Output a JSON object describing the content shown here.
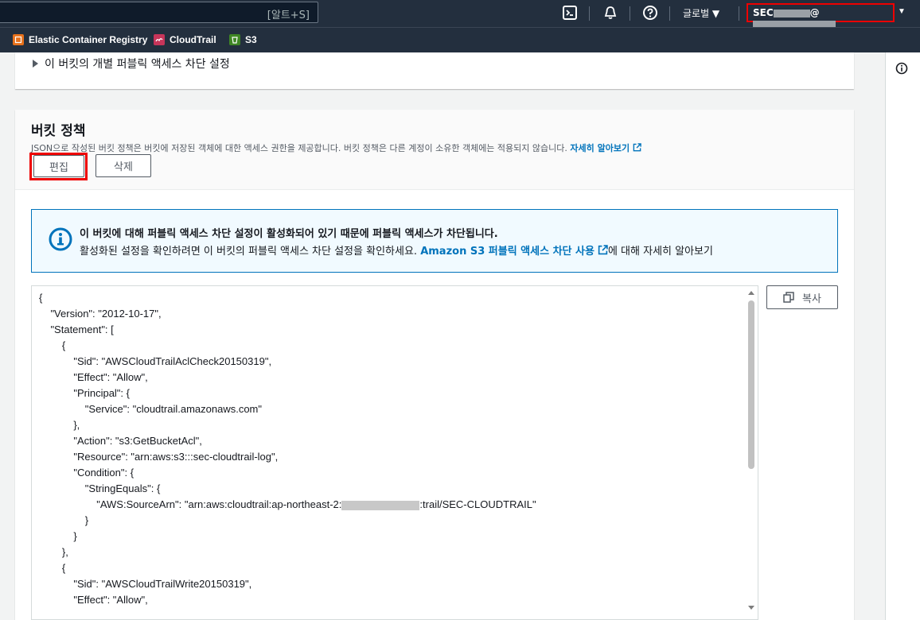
{
  "topnav": {
    "search_shortcut": "[알트+S]",
    "region": "글로벌 ▼",
    "account_prefix": "SEC",
    "account_at": "@",
    "account_caret": "▼"
  },
  "favorites": [
    {
      "label": "Elastic Container Registry",
      "icon": "ecr-icon",
      "color": "#e7711b"
    },
    {
      "label": "CloudTrail",
      "icon": "cloudtrail-icon",
      "color": "#c7355a"
    },
    {
      "label": "S3",
      "icon": "s3-icon",
      "color": "#3f8624"
    }
  ],
  "block_settings": {
    "expander_label": "이 버킷의 개별 퍼블릭 액세스 차단 설정"
  },
  "policy": {
    "title": "버킷 정책",
    "description": "JSON으로 작성된 버킷 정책은 버킷에 저장된 객체에 대한 액세스 권한을 제공합니다. 버킷 정책은 다른 계정이 소유한 객체에는 적용되지 않습니다.",
    "learn_more": "자세히 알아보기",
    "edit_label": "편집",
    "delete_label": "삭제",
    "copy_label": "복사"
  },
  "alert": {
    "title": "이 버킷에 대해 퍼블릭 액세스 차단 설정이 활성화되어 있기 때문에 퍼블릭 액세스가 차단됩니다.",
    "body_prefix": "활성화된 설정을 확인하려면 이 버킷의 퍼블릭 액세스 차단 설정을 확인하세요.",
    "link": "Amazon S3 퍼블릭 액세스 차단 사용",
    "body_suffix": "에 대해 자세히 알아보기"
  },
  "code_lines": [
    "{",
    "    \"Version\": \"2012-10-17\",",
    "    \"Statement\": [",
    "        {",
    "            \"Sid\": \"AWSCloudTrailAclCheck20150319\",",
    "            \"Effect\": \"Allow\",",
    "            \"Principal\": {",
    "                \"Service\": \"cloudtrail.amazonaws.com\"",
    "            },",
    "            \"Action\": \"s3:GetBucketAcl\",",
    "            \"Resource\": \"arn:aws:s3:::sec-cloudtrail-log\",",
    "            \"Condition\": {",
    "                \"StringEquals\": {",
    "                    \"AWS:SourceArn\": \"arn:aws:cloudtrail:ap-northeast-2:",
    "                }",
    "            }",
    "        },",
    "        {",
    "            \"Sid\": \"AWSCloudTrailWrite20150319\",",
    "            \"Effect\": \"Allow\","
  ],
  "code_arn_suffix": ":trail/SEC-CLOUDTRAIL\""
}
